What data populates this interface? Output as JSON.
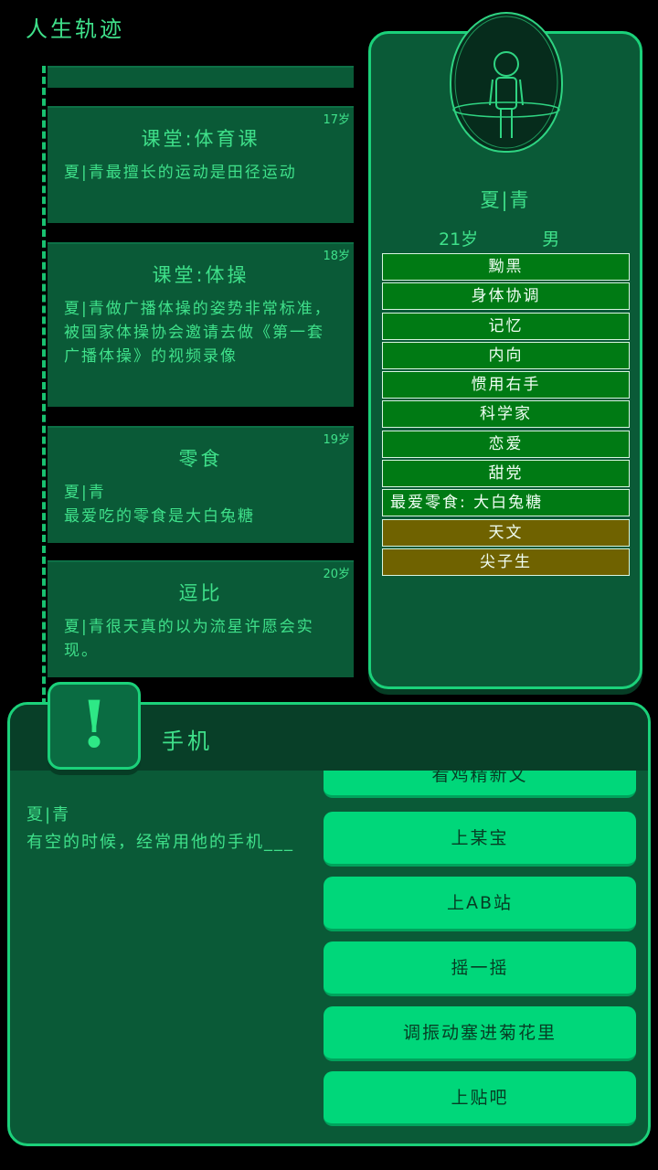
{
  "page_title": "人生轨迹",
  "timeline": {
    "top_card_partial": "...",
    "cards": [
      {
        "age": "17岁",
        "title": "课堂:体育课",
        "body": "夏|青最擅长的运动是田径运动"
      },
      {
        "age": "18岁",
        "title": "课堂:体操",
        "body": "夏|青做广播体操的姿势非常标准，被国家体操协会邀请去做《第一套广播体操》的视频录像"
      },
      {
        "age": "19岁",
        "title": "零食",
        "body": "夏|青\n最爱吃的零食是大白兔糖"
      },
      {
        "age": "20岁",
        "title": "逗比",
        "body": "夏|青很天真的以为流星许愿会实现。"
      }
    ]
  },
  "profile": {
    "name": "夏|青",
    "age": "21岁",
    "gender": "男",
    "tags": [
      {
        "label": "黝黑",
        "color": "green"
      },
      {
        "label": "身体协调",
        "color": "green"
      },
      {
        "label": "记忆",
        "color": "green"
      },
      {
        "label": "内向",
        "color": "green"
      },
      {
        "label": "惯用右手",
        "color": "green"
      },
      {
        "label": "科学家",
        "color": "green"
      },
      {
        "label": "恋爱",
        "color": "green"
      },
      {
        "label": "甜党",
        "color": "green"
      },
      {
        "label": "最爱零食: 大白兔糖",
        "color": "green"
      },
      {
        "label": "天文",
        "color": "gold"
      },
      {
        "label": "尖子生",
        "color": "gold"
      }
    ]
  },
  "dialog": {
    "icon": "exclamation-icon",
    "title": "手机",
    "text": "夏|青\n有空的时候，经常用他的手机___",
    "options": [
      "看鸡精新文",
      "上某宝",
      "上AB站",
      "摇一摇",
      "调振动塞进菊花里",
      "上贴吧"
    ]
  },
  "colors": {
    "panel": "#0a5a37",
    "accent": "#1bd17a",
    "option": "#00d77a",
    "tag_green": "#007a14",
    "tag_gold": "#6f6200"
  }
}
